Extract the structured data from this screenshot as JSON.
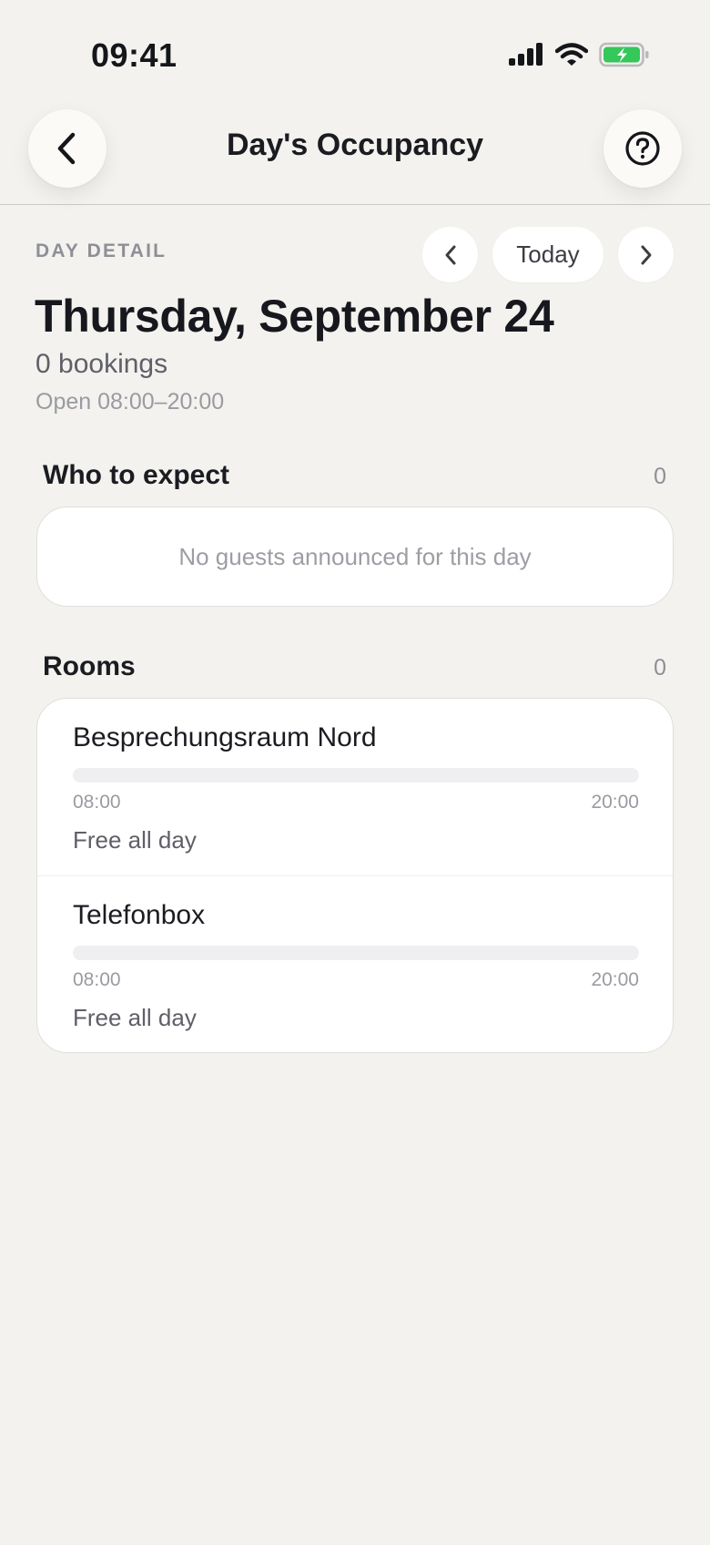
{
  "status_bar": {
    "time": "09:41",
    "icons": [
      "signal-icon",
      "wifi-icon",
      "battery-charging-icon"
    ],
    "battery_color": "#34c759"
  },
  "header": {
    "title": "Day's Occupancy",
    "back_icon": "chevron-left-icon",
    "help_icon": "question-circle-icon"
  },
  "day": {
    "eyebrow": "DAY DETAIL",
    "nav": {
      "prev_icon": "chevron-left-icon",
      "today_label": "Today",
      "next_icon": "chevron-right-icon"
    },
    "date": "Thursday, September 24",
    "bookings": "0 bookings",
    "hours": "Open 08:00–20:00"
  },
  "guests": {
    "title": "Who to expect",
    "count": "0",
    "empty_text": "No guests announced for this day"
  },
  "rooms": {
    "title": "Rooms",
    "count": "0",
    "items": [
      {
        "name": "Besprechungsraum Nord",
        "start": "08:00",
        "end": "20:00",
        "occupancy": 0,
        "status": "Free all day"
      },
      {
        "name": "Telefonbox",
        "start": "08:00",
        "end": "20:00",
        "occupancy": 0,
        "status": "Free all day"
      }
    ]
  }
}
